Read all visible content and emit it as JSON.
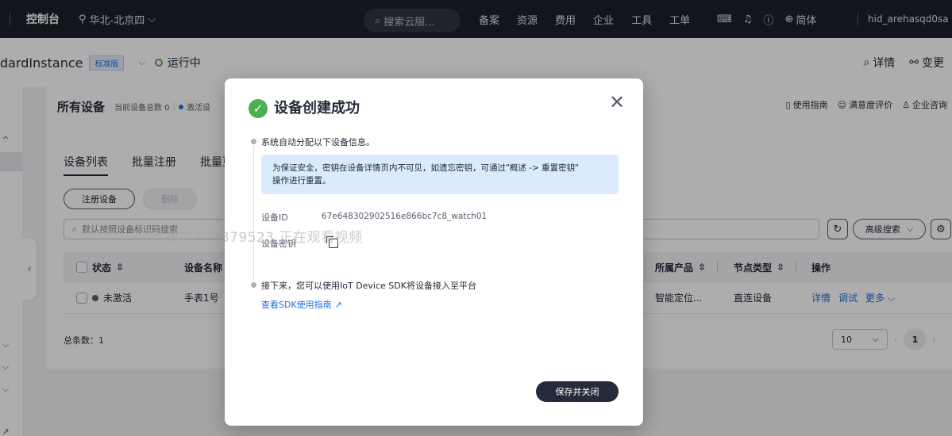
{
  "topbar": {
    "console": "控制台",
    "region": "华北-北京四",
    "search_placeholder": "搜索云服...",
    "nav": [
      "备案",
      "资源",
      "费用",
      "企业",
      "工具",
      "工单"
    ],
    "lang": "简体",
    "user": "hid_arehasqd0sa"
  },
  "instance": {
    "name": "dardInstance",
    "edition_badge": "标准版",
    "status": "运行中",
    "actions": {
      "detail": "详情",
      "change": "变更"
    }
  },
  "card": {
    "title": "所有设备",
    "meta_total": "当前设备总数 0",
    "meta_active": "激活设",
    "links": {
      "guide": "使用指南",
      "survey": "满意度评价",
      "consult": "企业咨询"
    },
    "tabs": [
      "设备列表",
      "批量注册",
      "批量更"
    ],
    "buttons": {
      "register": "注册设备",
      "delete": "删除"
    },
    "filter_placeholder": "默认按照设备标识码搜索",
    "advanced_search": "高级搜索",
    "columns": {
      "status": "状态",
      "name": "设备名称",
      "product": "所属产品",
      "node_type": "节点类型",
      "actions": "操作"
    },
    "rows": [
      {
        "status": "未激活",
        "name": "手表1号",
        "product": "智能定位...",
        "node_type": "直连设备",
        "op_detail": "详情",
        "op_debug": "调试",
        "op_more": "更多"
      }
    ],
    "total": "总条数：1",
    "page_size": "10",
    "current_page": "1"
  },
  "modal": {
    "title": "设备创建成功",
    "step1": "系统自动分配以下设备信息。",
    "notice_line1": "为保证安全，密钥在设备详情页内不可见，如遗忘密钥，可通过\"概述 -> 重置密钥\"",
    "notice_line2": "操作进行重置。",
    "device_id_label": "设备ID",
    "device_id_value": "67e648302902516e866bc7c8_watch01",
    "secret_label": "设备密钥",
    "step2": "接下来，您可以使用IoT Device SDK将设备接入至平台",
    "sdk_link": "查看SDK使用指南",
    "save_button": "保存并关闭"
  },
  "watermark": "博学谷 1879523 正在观看视频",
  "colors": {
    "success": "#4caf50",
    "link": "#1e6fd9",
    "notice_bg": "#dceafd",
    "topbar": "#1b1f2a"
  }
}
